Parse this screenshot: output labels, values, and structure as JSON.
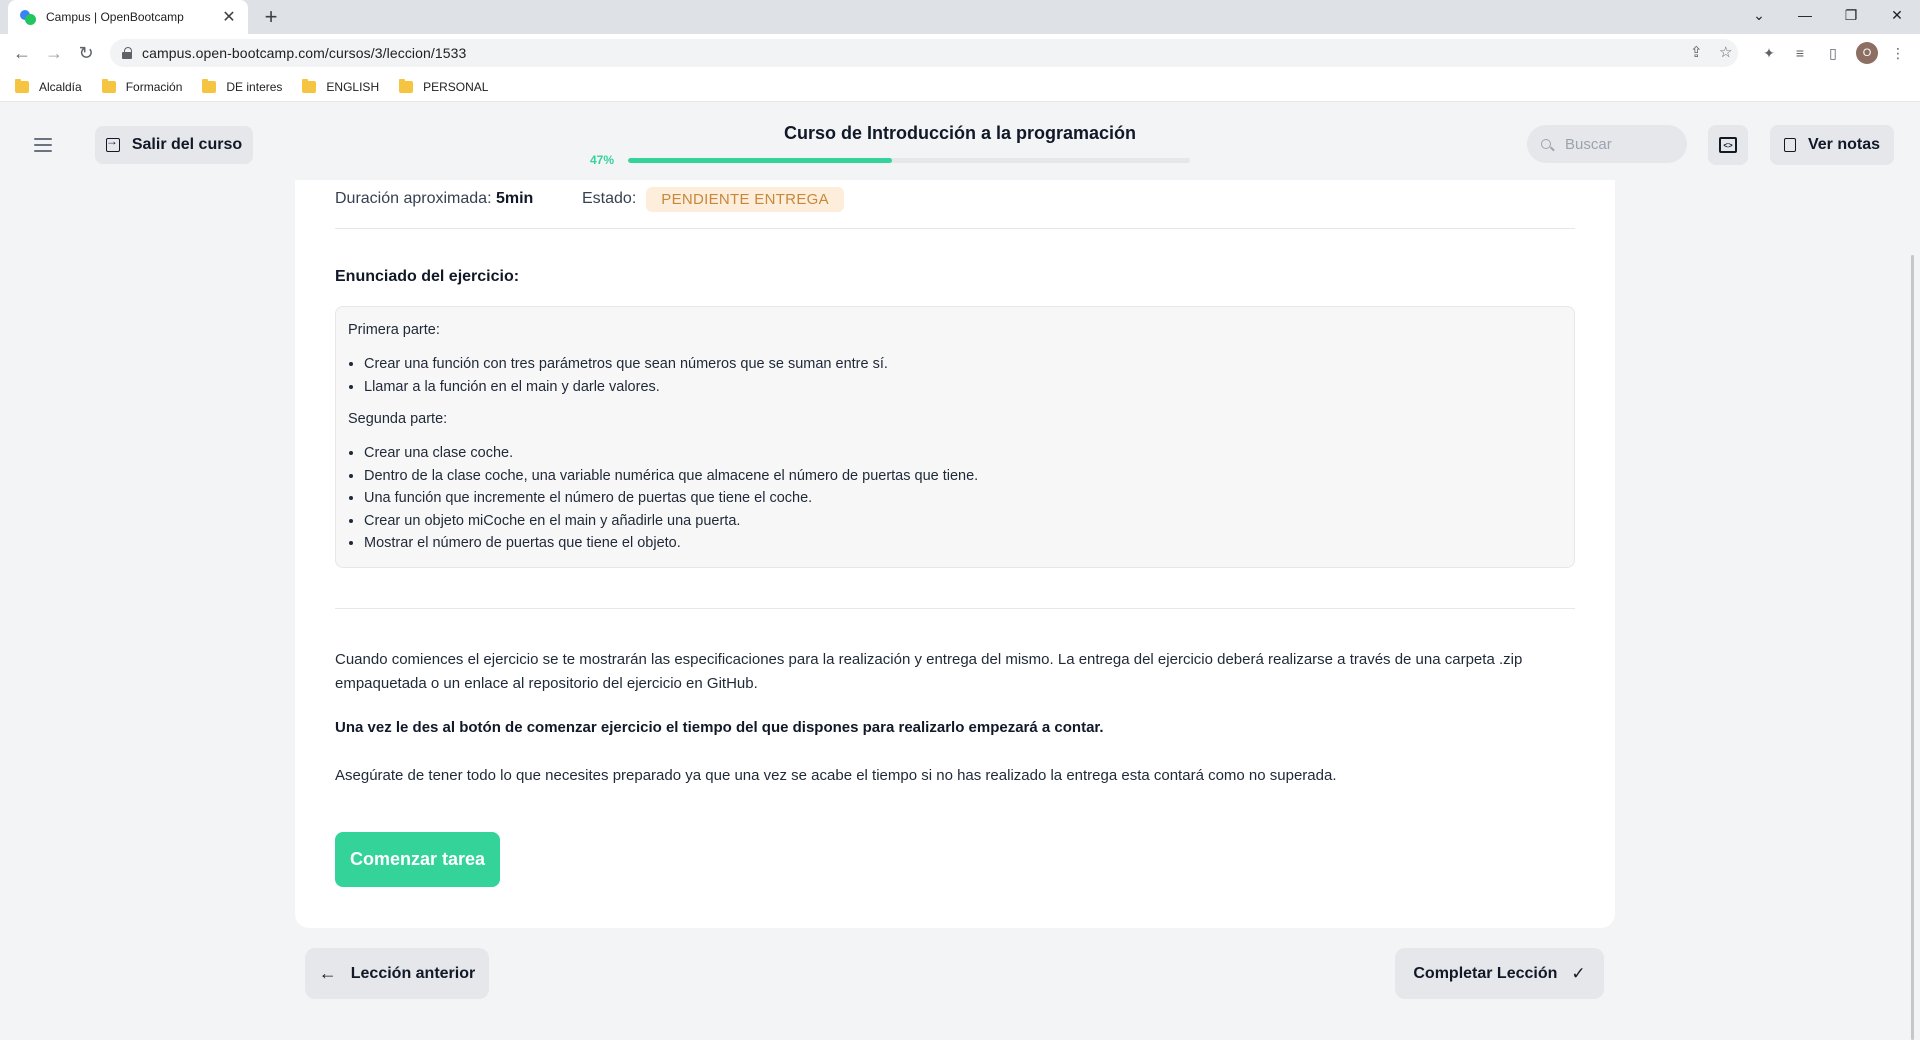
{
  "browser": {
    "tab_title": "Campus | OpenBootcamp",
    "tab_close": "✕",
    "new_tab": "+",
    "url": "campus.open-bootcamp.com/cursos/3/leccion/1533",
    "profile_initial": "O",
    "bookmarks": [
      "Alcaldía",
      "Formación",
      "DE interes",
      "ENGLISH",
      "PERSONAL"
    ]
  },
  "header": {
    "exit_label": "Salir del curso",
    "course_title": "Curso de Introducción a la programación",
    "progress_label": "47%",
    "progress_value": 0.47,
    "search_placeholder": "Buscar",
    "notes_label": "Ver notas"
  },
  "lesson": {
    "duration_label": "Duración aproximada:",
    "duration_value": "5min",
    "status_label": "Estado:",
    "status_value": "PENDIENTE ENTREGA",
    "section_title": "Enunciado del ejercicio:",
    "part1_title": "Primera parte:",
    "part1_items": [
      "Crear una función con tres parámetros que sean números que se suman entre sí.",
      "Llamar a la función en el main y darle valores."
    ],
    "part2_title": "Segunda parte:",
    "part2_items": [
      "Crear una clase coche.",
      "Dentro de la clase coche, una variable numérica que almacene el número de puertas que tiene.",
      "Una función que incremente el número de puertas que tiene el coche.",
      "Crear un objeto miCoche en el main y añadirle una puerta.",
      "Mostrar el número de puertas que tiene el objeto."
    ],
    "info_paragraph": "Cuando comiences el ejercicio se te mostrarán las especificaciones para la realización y entrega del mismo. La entrega del ejercicio deberá realizarse a través de una carpeta .zip empaquetada o un enlace al repositorio del ejercicio en GitHub.",
    "warning_paragraph": "Una vez le des al botón de comenzar ejercicio el tiempo del que dispones para realizarlo empezará a contar.",
    "note_paragraph": "Asegúrate de tener todo lo que necesites preparado ya que una vez se acabe el tiempo si no has realizado la entrega esta contará como no superada.",
    "start_button": "Comenzar tarea"
  },
  "footer_nav": {
    "prev_label": "Lección anterior",
    "complete_label": "Completar Lección"
  },
  "colors": {
    "accent": "#34d399",
    "badge_bg": "#fdeedc",
    "badge_text": "#c8873a"
  }
}
